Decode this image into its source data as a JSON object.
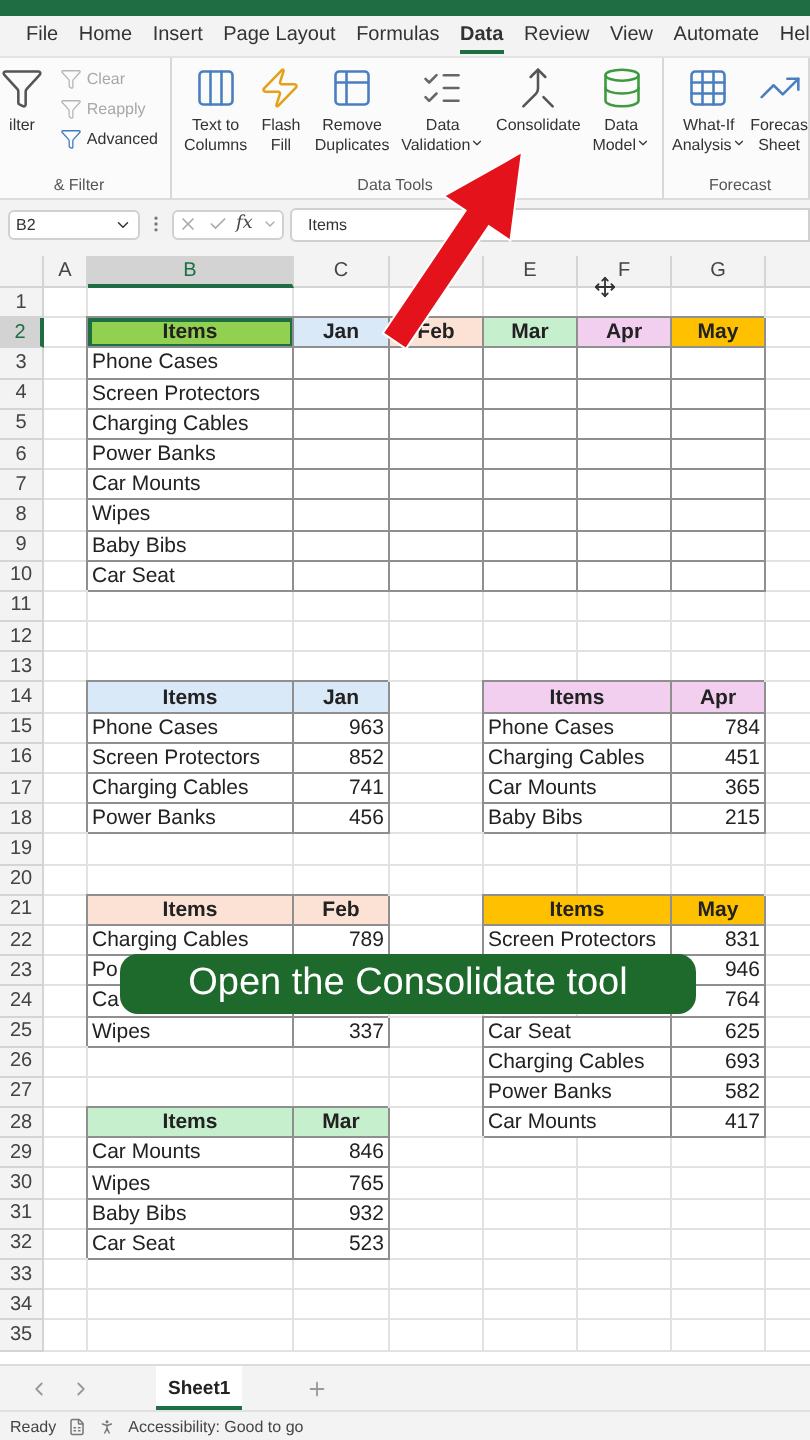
{
  "menu_tabs": [
    {
      "label": "File",
      "selected": false
    },
    {
      "label": "Home",
      "selected": false
    },
    {
      "label": "Insert",
      "selected": false
    },
    {
      "label": "Page Layout",
      "selected": false
    },
    {
      "label": "Formulas",
      "selected": false
    },
    {
      "label": "Data",
      "selected": true
    },
    {
      "label": "Review",
      "selected": false
    },
    {
      "label": "View",
      "selected": false
    },
    {
      "label": "Automate",
      "selected": false
    },
    {
      "label": "Hel",
      "selected": false
    }
  ],
  "ribbon_groups": [
    {
      "label": "& Filter",
      "large_buttons": [
        {
          "lines": [
            "ilter"
          ],
          "dropdown": false
        }
      ],
      "small_buttons": [
        {
          "label": "Clear",
          "disabled": true
        },
        {
          "label": "Reapply",
          "disabled": true
        },
        {
          "label": "Advanced",
          "disabled": false
        }
      ]
    },
    {
      "label": "Data Tools",
      "large_buttons": [
        {
          "lines": [
            "Text to",
            "Columns"
          ],
          "dropdown": false
        },
        {
          "lines": [
            "Flash",
            "Fill"
          ],
          "dropdown": false
        },
        {
          "lines": [
            "Remove",
            "Duplicates"
          ],
          "dropdown": false
        },
        {
          "lines": [
            "Data",
            "Validation"
          ],
          "dropdown": true
        },
        {
          "lines": [
            "Consolidate"
          ],
          "dropdown": false
        },
        {
          "lines": [
            "Data",
            "Model"
          ],
          "dropdown": true
        }
      ]
    },
    {
      "label": "Forecast",
      "large_buttons": [
        {
          "lines": [
            "What-If",
            "Analysis"
          ],
          "dropdown": true
        },
        {
          "lines": [
            "Forecas",
            "Sheet"
          ],
          "dropdown": false
        }
      ]
    }
  ],
  "formula_bar": {
    "name_box": "B2",
    "function_label": "fx",
    "value": "Items"
  },
  "columns": [
    {
      "label": "A",
      "selected": false
    },
    {
      "label": "B",
      "selected": true
    },
    {
      "label": "C",
      "selected": false
    },
    {
      "selected": false
    },
    {
      "label": "E",
      "selected": false
    },
    {
      "label": "F",
      "selected": false
    },
    {
      "label": "G",
      "selected": false
    }
  ],
  "rows": [
    {
      "number": "1",
      "selected": false
    },
    {
      "number": "2",
      "selected": true,
      "cells": [
        {
          "kind": "empty"
        },
        {
          "kind": "header",
          "text": "Items",
          "color": "#92d050",
          "selected": true
        },
        {
          "kind": "header",
          "text": "Jan",
          "color": "#dae9f8",
          "selected": false
        },
        {
          "kind": "header",
          "text": "Feb",
          "color": "#fbe2d5",
          "selected": false
        },
        {
          "kind": "header",
          "text": "Mar",
          "color": "#c6efce",
          "selected": false
        },
        {
          "kind": "header",
          "text": "Apr",
          "color": "#f2ceef",
          "selected": false
        },
        {
          "kind": "header",
          "text": "May",
          "color": "#ffc000",
          "selected": false
        }
      ]
    },
    {
      "number": "3",
      "selected": false,
      "cells": [
        {
          "kind": "empty"
        },
        {
          "kind": "text",
          "text": "Phone Cases",
          "selected": false
        },
        {
          "kind": "blank",
          "selected": false
        },
        {
          "kind": "blank",
          "selected": false
        },
        {
          "kind": "blank",
          "selected": false
        },
        {
          "kind": "blank",
          "selected": false
        },
        {
          "kind": "blank",
          "selected": false
        }
      ]
    },
    {
      "number": "4",
      "selected": false,
      "cells": [
        {
          "kind": "empty"
        },
        {
          "kind": "text",
          "text": "Screen Protectors",
          "selected": false
        },
        {
          "kind": "blank",
          "selected": false
        },
        {
          "kind": "blank",
          "selected": false
        },
        {
          "kind": "blank",
          "selected": false
        },
        {
          "kind": "blank",
          "selected": false
        },
        {
          "kind": "blank",
          "selected": false
        }
      ]
    },
    {
      "number": "5",
      "selected": false,
      "cells": [
        {
          "kind": "empty"
        },
        {
          "kind": "text",
          "text": "Charging Cables",
          "selected": false
        },
        {
          "kind": "blank",
          "selected": false
        },
        {
          "kind": "blank",
          "selected": false
        },
        {
          "kind": "blank",
          "selected": false
        },
        {
          "kind": "blank",
          "selected": false
        },
        {
          "kind": "blank",
          "selected": false
        }
      ]
    },
    {
      "number": "6",
      "selected": false,
      "cells": [
        {
          "kind": "empty"
        },
        {
          "kind": "text",
          "text": "Power Banks",
          "selected": false
        },
        {
          "kind": "blank",
          "selected": false
        },
        {
          "kind": "blank",
          "selected": false
        },
        {
          "kind": "blank",
          "selected": false
        },
        {
          "kind": "blank",
          "selected": false
        },
        {
          "kind": "blank",
          "selected": false
        }
      ]
    },
    {
      "number": "7",
      "selected": false,
      "cells": [
        {
          "kind": "empty"
        },
        {
          "kind": "text",
          "text": "Car Mounts",
          "selected": false
        },
        {
          "kind": "blank",
          "selected": false
        },
        {
          "kind": "blank",
          "selected": false
        },
        {
          "kind": "blank",
          "selected": false
        },
        {
          "kind": "blank",
          "selected": false
        },
        {
          "kind": "blank",
          "selected": false
        }
      ]
    },
    {
      "number": "8",
      "selected": false,
      "cells": [
        {
          "kind": "empty"
        },
        {
          "kind": "text",
          "text": "Wipes",
          "selected": false
        },
        {
          "kind": "blank",
          "selected": false
        },
        {
          "kind": "blank",
          "selected": false
        },
        {
          "kind": "blank",
          "selected": false
        },
        {
          "kind": "blank",
          "selected": false
        },
        {
          "kind": "blank",
          "selected": false
        }
      ]
    },
    {
      "number": "9",
      "selected": false,
      "cells": [
        {
          "kind": "empty"
        },
        {
          "kind": "text",
          "text": "Baby Bibs",
          "selected": false
        },
        {
          "kind": "blank",
          "selected": false
        },
        {
          "kind": "blank",
          "selected": false
        },
        {
          "kind": "blank",
          "selected": false
        },
        {
          "kind": "blank",
          "selected": false
        },
        {
          "kind": "blank",
          "selected": false
        }
      ]
    },
    {
      "number": "10",
      "selected": false,
      "cells": [
        {
          "kind": "empty"
        },
        {
          "kind": "text",
          "text": "Car Seat",
          "selected": false
        },
        {
          "kind": "blank",
          "selected": false
        },
        {
          "kind": "blank",
          "selected": false
        },
        {
          "kind": "blank",
          "selected": false
        },
        {
          "kind": "blank",
          "selected": false
        },
        {
          "kind": "blank",
          "selected": false
        }
      ]
    },
    {
      "number": "11",
      "selected": false
    },
    {
      "number": "12",
      "selected": false
    },
    {
      "number": "13",
      "selected": false
    },
    {
      "number": "14",
      "selected": false,
      "cells": [
        {
          "kind": "empty"
        },
        {
          "kind": "header",
          "text": "Items",
          "color": "#dae9f8",
          "selected": false
        },
        {
          "kind": "header",
          "text": "Jan",
          "color": "#dae9f8",
          "selected": false
        },
        {
          "kind": "empty"
        },
        {
          "kind": "header",
          "text": "Items",
          "color": "#f2ceef",
          "merged": true,
          "selected": false
        },
        {
          "kind": "header",
          "text": "Apr",
          "color": "#f2ceef",
          "selected": false
        }
      ]
    },
    {
      "number": "15",
      "selected": false,
      "cells": [
        {
          "kind": "empty"
        },
        {
          "kind": "text",
          "text": "Phone Cases",
          "selected": false
        },
        {
          "kind": "number",
          "text": "963",
          "selected": false
        },
        {
          "kind": "empty"
        },
        {
          "kind": "text",
          "text": "Phone Cases",
          "merged": true,
          "selected": false
        },
        {
          "kind": "number",
          "text": "784",
          "selected": false
        }
      ]
    },
    {
      "number": "16",
      "selected": false,
      "cells": [
        {
          "kind": "empty"
        },
        {
          "kind": "text",
          "text": "Screen Protectors",
          "selected": false
        },
        {
          "kind": "number",
          "text": "852",
          "selected": false
        },
        {
          "kind": "empty"
        },
        {
          "kind": "text",
          "text": "Charging Cables",
          "merged": true,
          "selected": false
        },
        {
          "kind": "number",
          "text": "451",
          "selected": false
        }
      ]
    },
    {
      "number": "17",
      "selected": false,
      "cells": [
        {
          "kind": "empty"
        },
        {
          "kind": "text",
          "text": "Charging Cables",
          "selected": false
        },
        {
          "kind": "number",
          "text": "741",
          "selected": false
        },
        {
          "kind": "empty"
        },
        {
          "kind": "text",
          "text": "Car Mounts",
          "merged": true,
          "selected": false
        },
        {
          "kind": "number",
          "text": "365",
          "selected": false
        }
      ]
    },
    {
      "number": "18",
      "selected": false,
      "cells": [
        {
          "kind": "empty"
        },
        {
          "kind": "text",
          "text": "Power Banks",
          "selected": false
        },
        {
          "kind": "number",
          "text": "456",
          "selected": false
        },
        {
          "kind": "empty"
        },
        {
          "kind": "text",
          "text": "Baby Bibs",
          "merged": true,
          "selected": false
        },
        {
          "kind": "number",
          "text": "215",
          "selected": false
        }
      ]
    },
    {
      "number": "19",
      "selected": false
    },
    {
      "number": "20",
      "selected": false
    },
    {
      "number": "21",
      "selected": false,
      "cells": [
        {
          "kind": "empty"
        },
        {
          "kind": "header",
          "text": "Items",
          "color": "#fbe2d5",
          "selected": false
        },
        {
          "kind": "header",
          "text": "Feb",
          "color": "#fbe2d5",
          "selected": false
        },
        {
          "kind": "empty"
        },
        {
          "kind": "header",
          "text": "Items",
          "color": "#ffc000",
          "merged": true,
          "selected": false
        },
        {
          "kind": "header",
          "text": "May",
          "color": "#ffc000",
          "selected": false
        }
      ]
    },
    {
      "number": "22",
      "selected": false,
      "cells": [
        {
          "kind": "empty"
        },
        {
          "kind": "text",
          "text": "Charging Cables",
          "selected": false
        },
        {
          "kind": "number",
          "text": "789",
          "selected": false
        },
        {
          "kind": "empty"
        },
        {
          "kind": "text",
          "text": "Screen Protectors",
          "merged": true,
          "selected": false
        },
        {
          "kind": "number",
          "text": "831",
          "selected": false
        }
      ]
    },
    {
      "number": "23",
      "selected": false,
      "cells": [
        {
          "kind": "empty"
        },
        {
          "kind": "text",
          "text": "Po",
          "selected": false
        },
        {
          "kind": "empty"
        },
        {
          "kind": "empty"
        },
        {
          "kind": "empty"
        },
        {
          "kind": "empty"
        },
        {
          "kind": "number",
          "text": "946",
          "selected": false
        }
      ]
    },
    {
      "number": "24",
      "selected": false,
      "cells": [
        {
          "kind": "empty"
        },
        {
          "kind": "text",
          "text": "Ca",
          "selected": false
        },
        {
          "kind": "empty"
        },
        {
          "kind": "empty"
        },
        {
          "kind": "empty"
        },
        {
          "kind": "empty"
        },
        {
          "kind": "number",
          "text": "764",
          "selected": false
        }
      ]
    },
    {
      "number": "25",
      "selected": false,
      "cells": [
        {
          "kind": "empty"
        },
        {
          "kind": "text",
          "text": "Wipes",
          "selected": false
        },
        {
          "kind": "number",
          "text": "337",
          "selected": false
        },
        {
          "kind": "empty"
        },
        {
          "kind": "text",
          "text": "Car Seat",
          "merged": true,
          "selected": false
        },
        {
          "kind": "number",
          "text": "625",
          "selected": false
        }
      ]
    },
    {
      "number": "26",
      "selected": false,
      "cells": [
        {
          "kind": "empty"
        },
        {
          "kind": "empty"
        },
        {
          "kind": "empty"
        },
        {
          "kind": "empty"
        },
        {
          "kind": "text",
          "text": "Charging Cables",
          "merged": true,
          "selected": false
        },
        {
          "kind": "number",
          "text": "693",
          "selected": false
        }
      ]
    },
    {
      "number": "27",
      "selected": false,
      "cells": [
        {
          "kind": "empty"
        },
        {
          "kind": "empty"
        },
        {
          "kind": "empty"
        },
        {
          "kind": "empty"
        },
        {
          "kind": "text",
          "text": "Power Banks",
          "merged": true,
          "selected": false
        },
        {
          "kind": "number",
          "text": "582",
          "selected": false
        }
      ]
    },
    {
      "number": "28",
      "selected": false,
      "cells": [
        {
          "kind": "empty"
        },
        {
          "kind": "header",
          "text": "Items",
          "color": "#c6efce",
          "selected": false
        },
        {
          "kind": "header",
          "text": "Mar",
          "color": "#c6efce",
          "selected": false
        },
        {
          "kind": "empty"
        },
        {
          "kind": "text",
          "text": "Car Mounts",
          "merged": true,
          "selected": false
        },
        {
          "kind": "number",
          "text": "417",
          "selected": false
        }
      ]
    },
    {
      "number": "29",
      "selected": false,
      "cells": [
        {
          "kind": "empty"
        },
        {
          "kind": "text",
          "text": "Car Mounts",
          "selected": false
        },
        {
          "kind": "number",
          "text": "846",
          "selected": false
        }
      ]
    },
    {
      "number": "30",
      "selected": false,
      "cells": [
        {
          "kind": "empty"
        },
        {
          "kind": "text",
          "text": "Wipes",
          "selected": false
        },
        {
          "kind": "number",
          "text": "765",
          "selected": false
        }
      ]
    },
    {
      "number": "31",
      "selected": false,
      "cells": [
        {
          "kind": "empty"
        },
        {
          "kind": "text",
          "text": "Baby Bibs",
          "selected": false
        },
        {
          "kind": "number",
          "text": "932",
          "selected": false
        }
      ]
    },
    {
      "number": "32",
      "selected": false,
      "cells": [
        {
          "kind": "empty"
        },
        {
          "kind": "text",
          "text": "Car Seat",
          "selected": false
        },
        {
          "kind": "number",
          "text": "523",
          "selected": false
        }
      ]
    },
    {
      "number": "33",
      "selected": false
    },
    {
      "number": "34",
      "selected": false
    },
    {
      "number": "35",
      "selected": false
    }
  ],
  "sheet_tabs": [
    {
      "label": "Sheet1",
      "selected": true
    }
  ],
  "caption": "Open the Consolidate tool",
  "status_bar": {
    "status": "Ready",
    "accessibility": "Accessibility: Good to go"
  }
}
